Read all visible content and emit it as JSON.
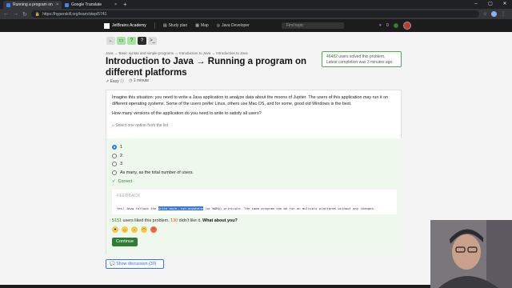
{
  "browser": {
    "tabs": [
      {
        "title": "Running a program on differe...",
        "active": true
      },
      {
        "title": "Google Translate",
        "active": false
      }
    ],
    "url": "https://hyperskill.org/learn/step/5741"
  },
  "header": {
    "logo": "JetBrains Academy",
    "study_plan": "Study plan",
    "map": "Map",
    "track": "Java Developer",
    "search_placeholder": "Find topic",
    "gems": "0"
  },
  "toolbar": [
    "←",
    "▭",
    "?",
    "?",
    ">_"
  ],
  "breadcrumb": "Java → Basic syntax and simple programs → Introduction to Java → Introduction to Java",
  "title": "Introduction to Java → Running a program on different platforms",
  "meta": {
    "difficulty": "Easy",
    "time": "1 minute"
  },
  "solved": {
    "count": "46482",
    "text": "users solved this problem.",
    "latest": "Latest completion was 3 minutes ago."
  },
  "question": {
    "p1": "Imagine this situation: you need to write a Java application to analyze data about the moons of Jupiter. The users of this application may run it on different operating systems. Some of the users prefer Linux, others use Mac OS, and for some, good old Windows is the best.",
    "p2": "How many versions of the application do you need to write to satisfy all users?",
    "hint": "Select one option from the list"
  },
  "options": [
    {
      "label": "1",
      "selected": true
    },
    {
      "label": "2",
      "selected": false
    },
    {
      "label": "3",
      "selected": false
    },
    {
      "label": "As many, as the total number of users.",
      "selected": false
    }
  ],
  "result": "Correct",
  "feedback": {
    "header": "FEEDBACK",
    "before": "Yes! Java follows the ",
    "highlight": "write once, run anywhere",
    "after": " (or WORA) principle. The same program can be run on multiple platforms without any changes."
  },
  "likes": {
    "liked": "5151",
    "liked_text": "users liked this problem.",
    "disliked": "130",
    "disliked_text": "didn't like it.",
    "question": "What about you?"
  },
  "continue": "Continue",
  "discussion": "Show discussion (30)",
  "colors": {
    "accent": "#2e7d32",
    "link": "#2962ff",
    "answer_bg": "#eef8ec"
  }
}
